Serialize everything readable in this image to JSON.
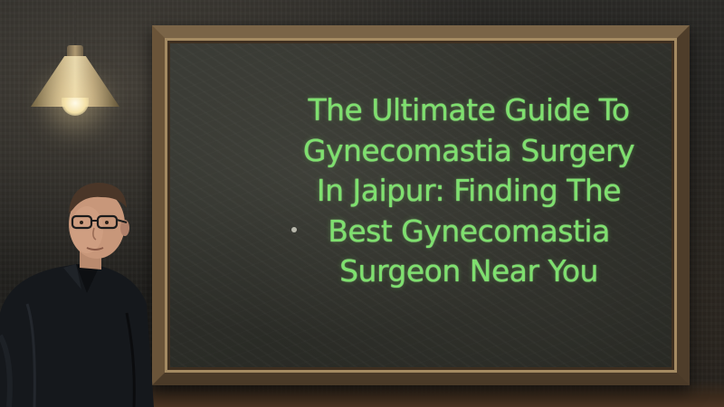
{
  "headline": {
    "lines": [
      "The Ultimate Guide To",
      "Gynecomastia Surgery",
      "In Jaipur: Finding The",
      "Best Gynecomastia",
      "Surgeon Near You"
    ],
    "color": "#7ee06e"
  },
  "scene": {
    "elements": [
      "pendant-lamp",
      "chalkboard",
      "man-with-glasses"
    ],
    "frame_color": "#5d4a33",
    "board_color": "#2f302b"
  }
}
